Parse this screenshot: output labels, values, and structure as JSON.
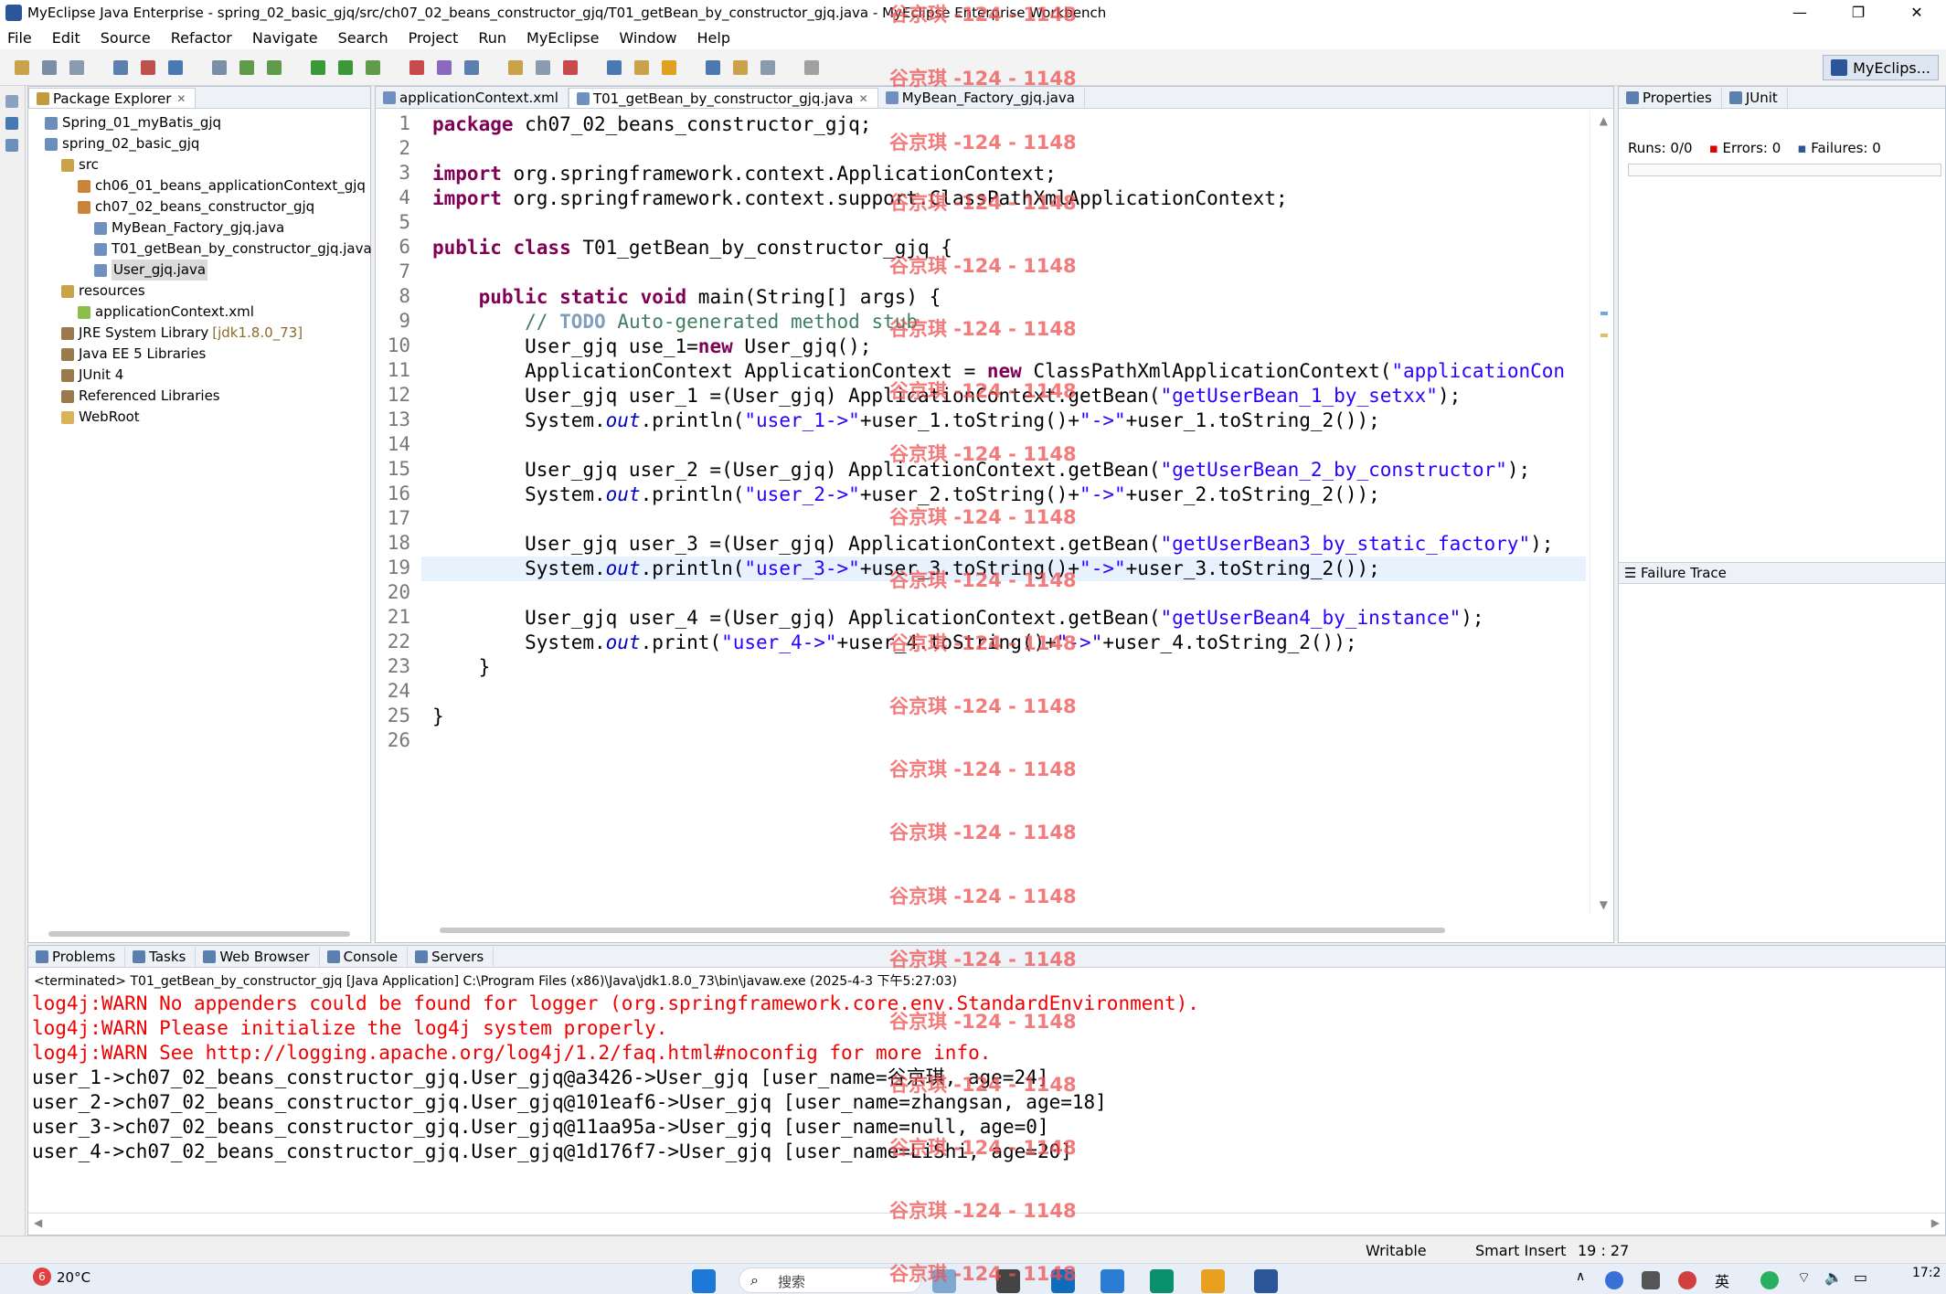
{
  "window": {
    "title": "MyEclipse Java Enterprise - spring_02_basic_gjq/src/ch07_02_beans_constructor_gjq/T01_getBean_by_constructor_gjq.java - MyEclipse Enterprise Workbench",
    "minimize": "—",
    "maximize": "❐",
    "close": "✕"
  },
  "menu": [
    "File",
    "Edit",
    "Source",
    "Refactor",
    "Navigate",
    "Search",
    "Project",
    "Run",
    "MyEclipse",
    "Window",
    "Help"
  ],
  "perspective": "MyEclips...",
  "package_explorer": {
    "tab": "Package Explorer",
    "tree": [
      {
        "label": "Spring_01_myBatis_gjq",
        "indent": 0,
        "icon": "project-icon"
      },
      {
        "label": "spring_02_basic_gjq",
        "indent": 0,
        "icon": "project-icon"
      },
      {
        "label": "src",
        "indent": 1,
        "icon": "source-folder-icon"
      },
      {
        "label": "ch06_01_beans_applicationContext_gjq",
        "indent": 2,
        "icon": "package-icon"
      },
      {
        "label": "ch07_02_beans_constructor_gjq",
        "indent": 2,
        "icon": "package-icon"
      },
      {
        "label": "MyBean_Factory_gjq.java",
        "indent": 3,
        "icon": "java-file-icon"
      },
      {
        "label": "T01_getBean_by_constructor_gjq.java",
        "indent": 3,
        "icon": "java-file-icon"
      },
      {
        "label": "User_gjq.java",
        "indent": 3,
        "icon": "java-file-icon",
        "selected": true
      },
      {
        "label": "resources",
        "indent": 1,
        "icon": "source-folder-icon"
      },
      {
        "label": "applicationContext.xml",
        "indent": 2,
        "icon": "xml-file-icon"
      },
      {
        "label": "JRE System Library",
        "decoration": "[jdk1.8.0_73]",
        "indent": 1,
        "icon": "library-icon"
      },
      {
        "label": "Java EE 5 Libraries",
        "indent": 1,
        "icon": "library-icon"
      },
      {
        "label": "JUnit 4",
        "indent": 1,
        "icon": "library-icon"
      },
      {
        "label": "Referenced Libraries",
        "indent": 1,
        "icon": "library-icon"
      },
      {
        "label": "WebRoot",
        "indent": 1,
        "icon": "folder-icon"
      }
    ]
  },
  "editor": {
    "tabs": [
      {
        "label": "applicationContext.xml",
        "active": false
      },
      {
        "label": "T01_getBean_by_constructor_gjq.java",
        "active": true
      },
      {
        "label": "MyBean_Factory_gjq.java",
        "active": false
      }
    ],
    "current_line": 19,
    "lines": [
      [
        [
          "kw",
          "package"
        ],
        [
          "t",
          " ch07_02_beans_constructor_gjq;"
        ]
      ],
      [],
      [
        [
          "kw",
          "import"
        ],
        [
          "t",
          " org.springframework.context.ApplicationContext;"
        ]
      ],
      [
        [
          "kw",
          "import"
        ],
        [
          "t",
          " org.springframework.context.support.ClassPathXmlApplicationContext;"
        ]
      ],
      [],
      [
        [
          "kw",
          "public class"
        ],
        [
          "t",
          " T01_getBean_by_constructor_gjq {"
        ]
      ],
      [],
      [
        [
          "t",
          "    "
        ],
        [
          "kw",
          "public static void"
        ],
        [
          "t",
          " main(String[] args) {"
        ]
      ],
      [
        [
          "t",
          "        "
        ],
        [
          "cm",
          "// "
        ],
        [
          "td",
          "TODO"
        ],
        [
          "cm",
          " Auto-generated method stub"
        ]
      ],
      [
        [
          "t",
          "        User_gjq use_1="
        ],
        [
          "kw",
          "new"
        ],
        [
          "t",
          " User_gjq();"
        ]
      ],
      [
        [
          "t",
          "        ApplicationContext ApplicationContext = "
        ],
        [
          "kw",
          "new"
        ],
        [
          "t",
          " ClassPathXmlApplicationContext("
        ],
        [
          "st",
          "\"applicationCon"
        ]
      ],
      [
        [
          "t",
          "        User_gjq user_1 =(User_gjq) ApplicationContext.getBean("
        ],
        [
          "st",
          "\"getUserBean_1_by_setxx\""
        ],
        [
          "t",
          ");"
        ]
      ],
      [
        [
          "t",
          "        System."
        ],
        [
          "it",
          "out"
        ],
        [
          "t",
          ".println("
        ],
        [
          "st",
          "\"user_1->\""
        ],
        [
          "t",
          "+user_1.toString()+"
        ],
        [
          "st",
          "\"->\""
        ],
        [
          "t",
          "+user_1.toString_2());"
        ]
      ],
      [],
      [
        [
          "t",
          "        User_gjq user_2 =(User_gjq) ApplicationContext.getBean("
        ],
        [
          "st",
          "\"getUserBean_2_by_constructor\""
        ],
        [
          "t",
          ");"
        ]
      ],
      [
        [
          "t",
          "        System."
        ],
        [
          "it",
          "out"
        ],
        [
          "t",
          ".println("
        ],
        [
          "st",
          "\"user_2->\""
        ],
        [
          "t",
          "+user_2.toString()+"
        ],
        [
          "st",
          "\"->\""
        ],
        [
          "t",
          "+user_2.toString_2());"
        ]
      ],
      [],
      [
        [
          "t",
          "        User_gjq user_3 =(User_gjq) ApplicationContext.getBean("
        ],
        [
          "st",
          "\"getUserBean3_by_static_factory\""
        ],
        [
          "t",
          ");"
        ]
      ],
      [
        [
          "t",
          "        System."
        ],
        [
          "it",
          "out"
        ],
        [
          "t",
          ".println("
        ],
        [
          "st",
          "\"user_3->\""
        ],
        [
          "t",
          "+user_3.toString()+"
        ],
        [
          "st",
          "\"->\""
        ],
        [
          "t",
          "+user_3.toString_2());"
        ]
      ],
      [],
      [
        [
          "t",
          "        User_gjq user_4 =(User_gjq) ApplicationContext.getBean("
        ],
        [
          "st",
          "\"getUserBean4_by_instance\""
        ],
        [
          "t",
          ");"
        ]
      ],
      [
        [
          "t",
          "        System."
        ],
        [
          "it",
          "out"
        ],
        [
          "t",
          ".print("
        ],
        [
          "st",
          "\"user_4->\""
        ],
        [
          "t",
          "+user_4.toString()+"
        ],
        [
          "st",
          "\"->\""
        ],
        [
          "t",
          "+user_4.toString_2());"
        ]
      ],
      [
        [
          "t",
          "    }"
        ]
      ],
      [],
      [
        [
          "t",
          "}"
        ]
      ],
      []
    ]
  },
  "junit": {
    "tabs": [
      {
        "label": "Properties"
      },
      {
        "label": "JUnit"
      }
    ],
    "runs_label": "Runs:",
    "runs": "0/0",
    "errors_label": "Errors:",
    "errors": "0",
    "failures_label": "Failures:",
    "failures": "0",
    "failure_trace": "Failure Trace"
  },
  "console": {
    "tabs": [
      {
        "label": "Problems"
      },
      {
        "label": "Tasks"
      },
      {
        "label": "Web Browser"
      },
      {
        "label": "Console"
      },
      {
        "label": "Servers"
      }
    ],
    "header": "<terminated> T01_getBean_by_constructor_gjq [Java Application] C:\\Program Files (x86)\\Java\\jdk1.8.0_73\\bin\\javaw.exe (2025-4-3 下午5:27:03)",
    "lines": [
      {
        "text": "log4j:WARN No appenders could be found for logger (org.springframework.core.env.StandardEnvironment).",
        "error": true
      },
      {
        "text": "log4j:WARN Please initialize the log4j system properly.",
        "error": true
      },
      {
        "text": "log4j:WARN See http://logging.apache.org/log4j/1.2/faq.html#noconfig for more info.",
        "error": true
      },
      {
        "text": "user_1->ch07_02_beans_constructor_gjq.User_gjq@a3426->User_gjq [user_name=谷京琪, age=24]",
        "error": false
      },
      {
        "text": "user_2->ch07_02_beans_constructor_gjq.User_gjq@101eaf6->User_gjq [user_name=zhangsan, age=18]",
        "error": false
      },
      {
        "text": "user_3->ch07_02_beans_constructor_gjq.User_gjq@11aa95a->User_gjq [user_name=null, age=0]",
        "error": false
      },
      {
        "text": "user_4->ch07_02_beans_constructor_gjq.User_gjq@1d176f7->User_gjq [user_name=LiShi, age=20]",
        "error": false
      }
    ]
  },
  "status": {
    "writable": "Writable",
    "insert_mode": "Smart Insert",
    "position": "19 : 27"
  },
  "taskbar": {
    "weather_badge": "6",
    "temperature": "20°C",
    "search_placeholder": "搜索",
    "ime": "英",
    "clock": "17:2"
  },
  "watermark": "谷京琪 -124 - 1148"
}
